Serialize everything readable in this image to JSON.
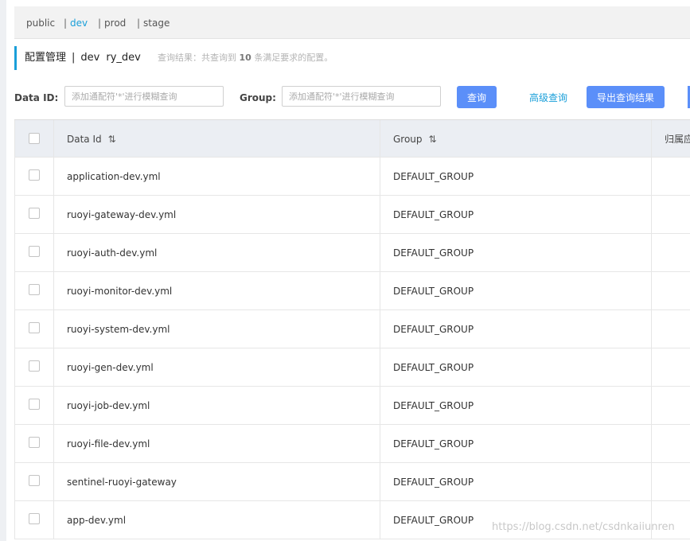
{
  "namespaces": [
    {
      "label": "public",
      "active": false
    },
    {
      "label": "dev",
      "active": true
    },
    {
      "label": "prod",
      "active": false
    },
    {
      "label": "stage",
      "active": false
    }
  ],
  "title": {
    "main": "配置管理",
    "separator": "|",
    "namespace": "dev",
    "namespace_id": "ry_dev",
    "result_prefix": "查询结果：共查询到",
    "result_count": "10",
    "result_suffix": "条满足要求的配置。"
  },
  "search": {
    "data_id_label": "Data ID:",
    "data_id_placeholder": "添加通配符'*'进行模糊查询",
    "group_label": "Group:",
    "group_placeholder": "添加通配符'*'进行模糊查询",
    "query_button": "查询",
    "advanced_link": "高级查询",
    "export_button": "导出查询结果"
  },
  "table": {
    "columns": {
      "data_id": "Data Id",
      "group": "Group",
      "app": "归属应"
    },
    "rows": [
      {
        "data_id": "application-dev.yml",
        "group": "DEFAULT_GROUP"
      },
      {
        "data_id": "ruoyi-gateway-dev.yml",
        "group": "DEFAULT_GROUP"
      },
      {
        "data_id": "ruoyi-auth-dev.yml",
        "group": "DEFAULT_GROUP"
      },
      {
        "data_id": "ruoyi-monitor-dev.yml",
        "group": "DEFAULT_GROUP"
      },
      {
        "data_id": "ruoyi-system-dev.yml",
        "group": "DEFAULT_GROUP"
      },
      {
        "data_id": "ruoyi-gen-dev.yml",
        "group": "DEFAULT_GROUP"
      },
      {
        "data_id": "ruoyi-job-dev.yml",
        "group": "DEFAULT_GROUP"
      },
      {
        "data_id": "ruoyi-file-dev.yml",
        "group": "DEFAULT_GROUP"
      },
      {
        "data_id": "sentinel-ruoyi-gateway",
        "group": "DEFAULT_GROUP"
      },
      {
        "data_id": "app-dev.yml",
        "group": "DEFAULT_GROUP"
      }
    ]
  },
  "watermark": "https://blog.csdn.net/csdnkaiiunren",
  "colors": {
    "accent": "#1a9fd9",
    "button": "#5b8ff9",
    "header_bg": "#ebeef3"
  }
}
